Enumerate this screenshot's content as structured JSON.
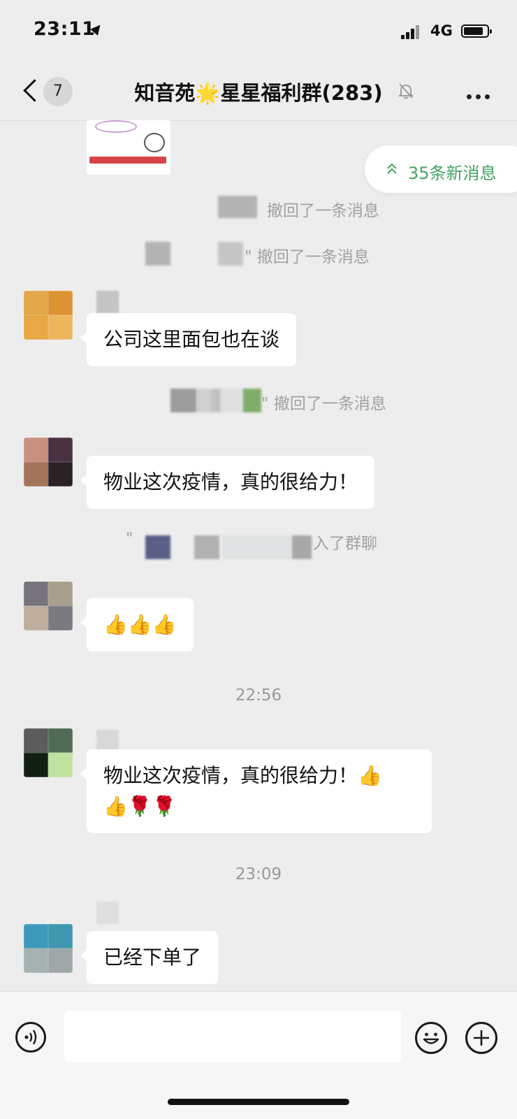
{
  "status_bar": {
    "time": "23:11",
    "network": "4G"
  },
  "nav": {
    "unread_badge": "7",
    "title_left": "知音苑",
    "title_star": "🌟",
    "title_right": "星星福利群(283)"
  },
  "new_messages": {
    "label": "35条新消息"
  },
  "messages": {
    "recall_1": "撤回了一条消息",
    "recall_2": "\" 撤回了一条消息",
    "msg_1": "公司这里面包也在谈",
    "recall_3": "\" 撤回了一条消息",
    "msg_2": "物业这次疫情，真的很给力！",
    "join_suffix": "入了群聊",
    "join_prefix": "\"",
    "msg_3": "👍👍👍",
    "time_1": "22:56",
    "msg_4_line1": "物业这次疫情，真的很给力！👍",
    "msg_4_line2": "👍🌹🌹",
    "time_2": "23:09",
    "msg_5": "已经下单了"
  },
  "colors": {
    "accent_green": "#45a260",
    "bubble": "#ffffff",
    "background": "#ededed"
  }
}
